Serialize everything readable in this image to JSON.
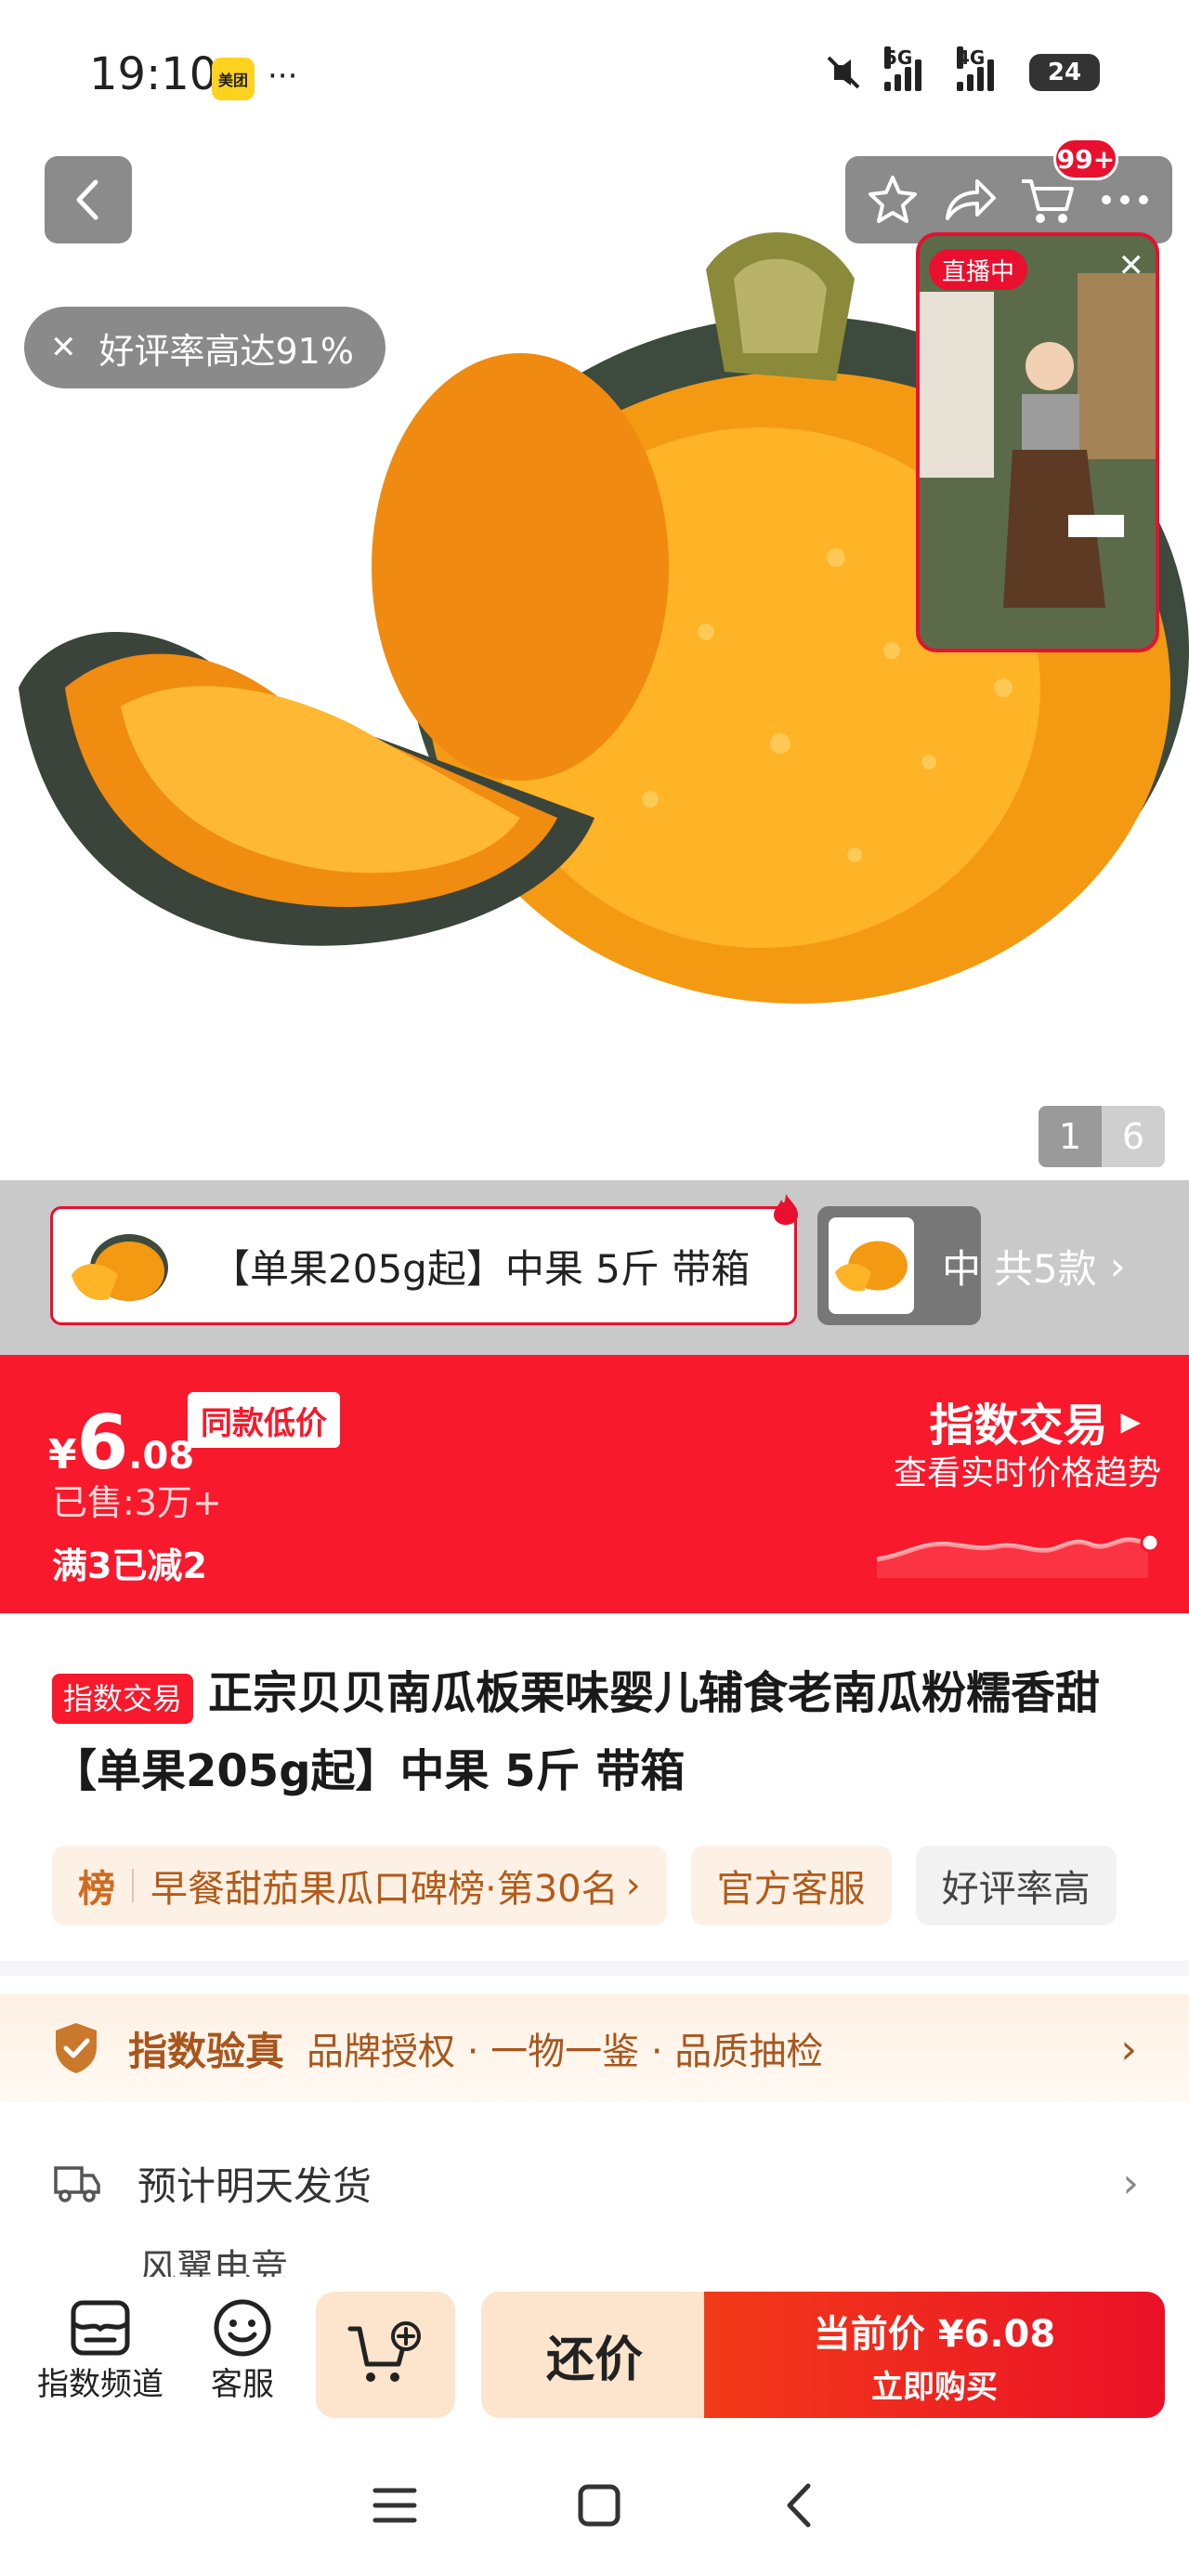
{
  "status_bar": {
    "time": "19:10",
    "app_badge": "美团",
    "more": "···",
    "net1": "5G",
    "net2": "4G",
    "battery": "24"
  },
  "hero": {
    "cart_badge": "99+",
    "rating_chip": "好评率高达91%",
    "live_tag": "直播中",
    "pager_current": "1",
    "pager_total": "6"
  },
  "sku": {
    "selected_label": "【单果205g起】中果 5斤 带箱",
    "second_label_cut": "中",
    "more_label": "共5款"
  },
  "price": {
    "symbol": "¥",
    "integer": "6",
    "decimal": ".08",
    "low_tag": "同款低价",
    "sold": "已售:3万+",
    "promo": "满3已减2",
    "index_title": "指数交易",
    "index_sub": "查看实时价格趋势"
  },
  "product": {
    "badge": "指数交易",
    "title": "正宗贝贝南瓜板栗味婴儿辅食老南瓜粉糯香甜 【单果205g起】中果 5斤 带箱"
  },
  "chips": {
    "rank_icon_label": "榜",
    "rank_text": "早餐甜茄果瓜口碑榜·第30名",
    "service": "官方客服",
    "rating": "好评率高"
  },
  "verify": {
    "title": "指数验真",
    "items": "品牌授权 · 一物一鉴 · 品质抽检"
  },
  "shipping": {
    "eta": "预计明天发货",
    "store": "风翼电竞"
  },
  "bottom_bar": {
    "channel": "指数频道",
    "service": "客服",
    "bargain": "还价",
    "buy_price": "当前价 ¥6.08",
    "buy_now": "立即购买"
  },
  "colors": {
    "brand_red": "#f8192c",
    "peach": "#fde4cc",
    "verify_brown": "#a8561d"
  }
}
